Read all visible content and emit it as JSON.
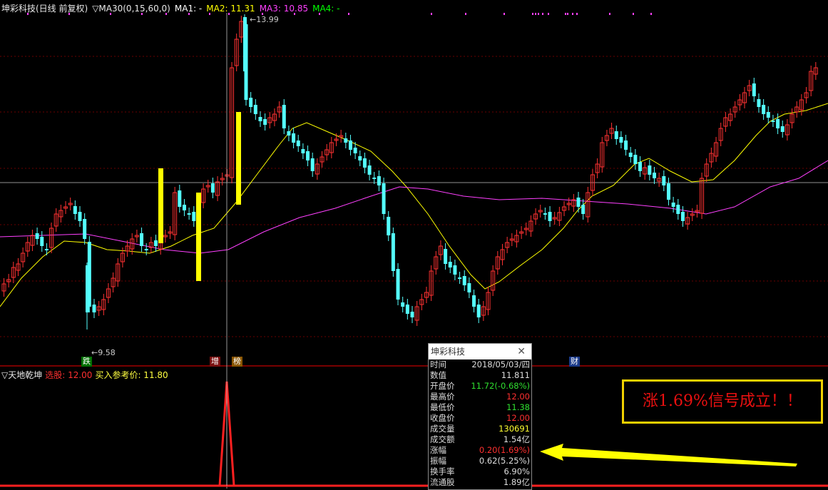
{
  "main_legend": {
    "title": "坤彩科技(日线 前复权)",
    "indicator": "▽MA30(0,15,60,0)",
    "ma1": "MA1: -",
    "ma2": "MA2: 11.31",
    "ma3": "MA3: 10.85",
    "ma4": "MA4: -",
    "colors": {
      "title": "#e8e8e8",
      "ma1": "#ffffff",
      "ma2": "#ffff00",
      "ma3": "#ff40ff",
      "ma4": "#00ff00"
    }
  },
  "annotations": {
    "high_label": "13.99",
    "low_label": "9.58"
  },
  "event_tags": [
    {
      "text": "跌",
      "bg": "#007000",
      "color": "#ffffff"
    },
    {
      "text": "增",
      "bg": "#7a1010",
      "color": "#ffffff"
    },
    {
      "text": "榜",
      "bg": "#8a5500",
      "color": "#ffffff"
    },
    {
      "text": "财",
      "bg": "#1a3a8a",
      "color": "#ffffff"
    }
  ],
  "indicator_legend": {
    "name": "▽天地乾坤",
    "select_label": "选股: 12.00",
    "buy_label": "买入参考价: 11.80"
  },
  "info_window": {
    "title": "坤彩科技",
    "rows": [
      {
        "k": "时间",
        "v": "2018/05/03/四",
        "c": "#dddddd"
      },
      {
        "k": "数值",
        "v": "11.811",
        "c": "#dddddd"
      },
      {
        "k": "开盘价",
        "v": "11.72(-0.68%)",
        "c": "#30e030"
      },
      {
        "k": "最高价",
        "v": "12.00",
        "c": "#ff3030"
      },
      {
        "k": "最低价",
        "v": "11.38",
        "c": "#30e030"
      },
      {
        "k": "收盘价",
        "v": "12.00",
        "c": "#ff3030"
      },
      {
        "k": "成交量",
        "v": "130691",
        "c": "#ffff30"
      },
      {
        "k": "成交额",
        "v": "1.54亿",
        "c": "#dddddd"
      },
      {
        "k": "涨幅",
        "v": "0.20(1.69%)",
        "c": "#ff3030"
      },
      {
        "k": "振幅",
        "v": "0.62(5.25%)",
        "c": "#dddddd"
      },
      {
        "k": "换手率",
        "v": "6.90%",
        "c": "#dddddd"
      },
      {
        "k": "流通股",
        "v": "1.89亿",
        "c": "#dddddd"
      }
    ]
  },
  "signal_text": "涨1.69%信号成立！！",
  "colors": {
    "up": "#ff3232",
    "down": "#54ffff",
    "ma2": "#ffff00",
    "ma3": "#ff40ff",
    "grid": "#6a0000",
    "crosshair": "#c0c0c0",
    "yellow_bar": "#ffff00",
    "arrow": "#ffff00",
    "spike": "#ff2020"
  }
}
